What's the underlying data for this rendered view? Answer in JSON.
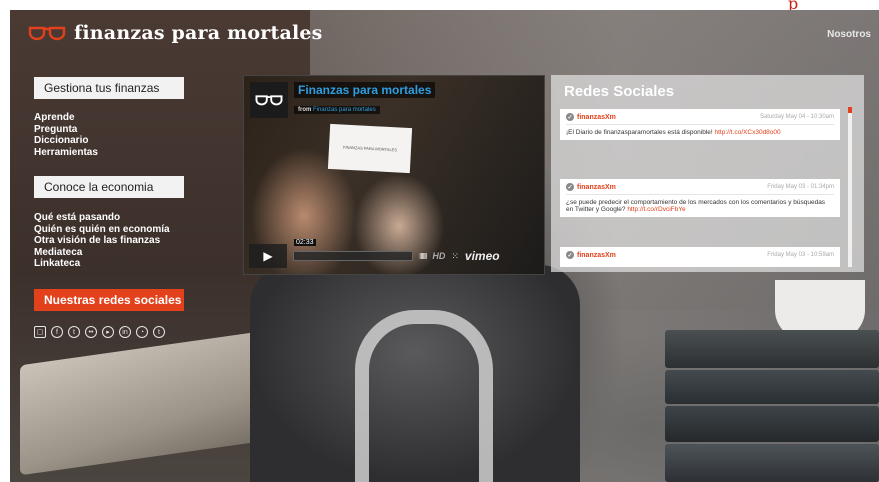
{
  "header": {
    "logo_text": "finanzas para mortales",
    "nav_right": "Nosotros"
  },
  "sidebar": {
    "section1": "Gestiona tus finanzas",
    "links1": [
      "Aprende",
      "Pregunta",
      "Diccionario",
      "Herramientas"
    ],
    "section2": "Conoce la economia",
    "links2": [
      "Qué está pasando",
      "Quién es quién en economía",
      "Otra visión de las finanzas",
      "Mediateca",
      "Linkateca"
    ],
    "social_button": "Nuestras redes sociales",
    "social_icons": [
      "instagram-icon",
      "facebook-icon",
      "twitter-icon",
      "flickr-icon",
      "youtube-icon",
      "linkedin-icon",
      "rss-icon",
      "tumblr-icon"
    ]
  },
  "video": {
    "title": "Finanzas para mortales",
    "from_label": "from",
    "from_channel": "Finanzas para mortales",
    "card_text": "FINANZAS PARA MORTALES",
    "time": "02:33",
    "hd": "HD",
    "brand": "vimeo"
  },
  "social_panel": {
    "title": "Redes Sociales",
    "tweets": [
      {
        "user": "finanzasXm",
        "date": "Saturday May 04 - 10:30am",
        "text": "¡El Diario de finanzasparamortales está disponible!",
        "link": "http://t.co/XCx30d8o00"
      },
      {
        "user": "finanzasXm",
        "date": "Friday May 03 - 01:34pm",
        "text": "¿se puede predecir el comportamiento de los mercados con los comentarios y búsquedas en Twitter y Google?",
        "link": "http://t.co/rDvciFbYe"
      },
      {
        "user": "finanzasXm",
        "date": "Friday May 03 - 10:59am",
        "text": "",
        "link": ""
      }
    ]
  },
  "colors": {
    "accent": "#e2411c",
    "video_title": "#2f9ee0"
  }
}
